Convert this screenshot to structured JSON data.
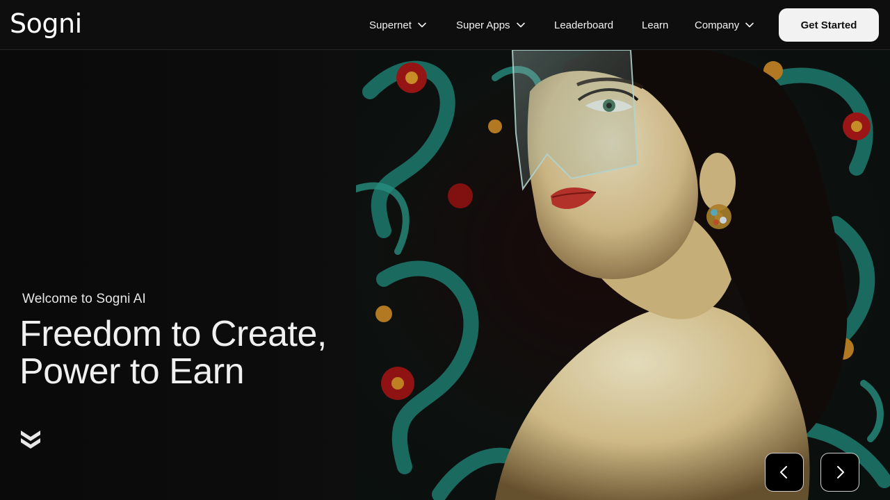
{
  "brand": {
    "logo_text": "Sogni"
  },
  "nav": {
    "items": [
      {
        "label": "Supernet",
        "has_dropdown": true
      },
      {
        "label": "Super Apps",
        "has_dropdown": true
      },
      {
        "label": "Leaderboard",
        "has_dropdown": false
      },
      {
        "label": "Learn",
        "has_dropdown": false
      },
      {
        "label": "Company",
        "has_dropdown": true
      }
    ],
    "cta_label": "Get Started"
  },
  "hero": {
    "eyebrow": "Welcome to Sogni AI",
    "headline_line1": "Freedom to Create,",
    "headline_line2": "Power to Earn",
    "scroll_icon": "double-chevron-down-icon",
    "image": "portrait-woman-ornate-background",
    "carousel": {
      "prev_icon": "chevron-left-icon",
      "next_icon": "chevron-right-icon"
    }
  },
  "colors": {
    "background": "#0b0b0b",
    "header": "#0e0e0e",
    "cta_bg": "#f2f2f2",
    "text": "#f0f0f0"
  }
}
